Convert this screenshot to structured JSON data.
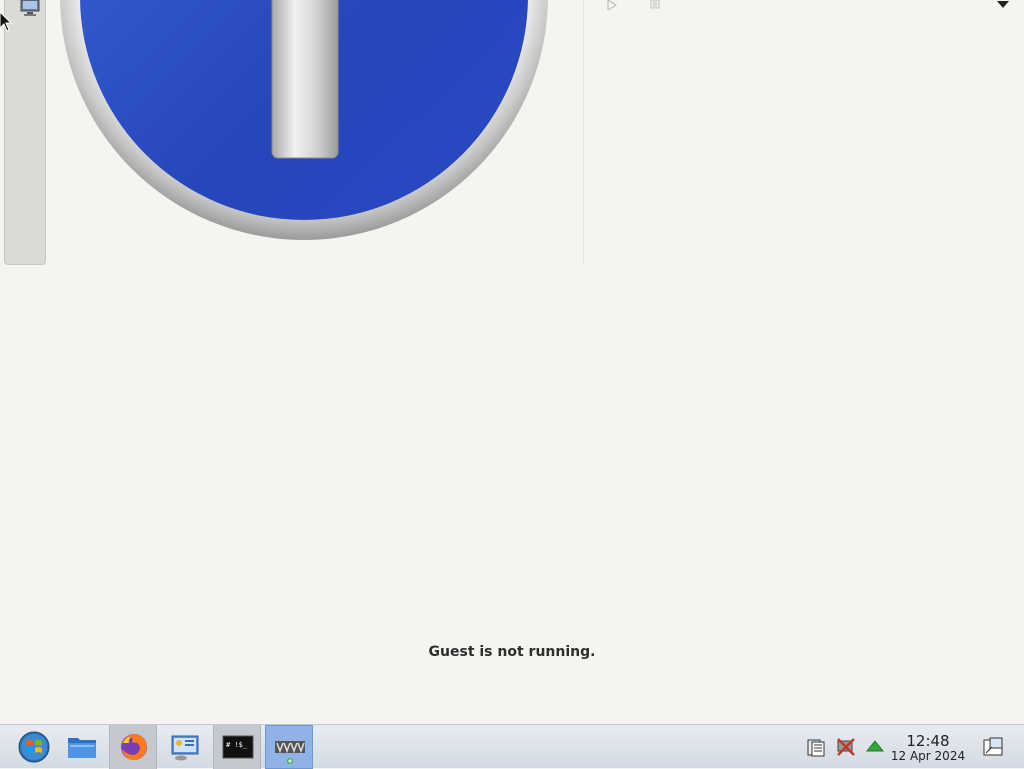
{
  "main": {
    "status_message": "Guest is not running."
  },
  "icons": {
    "sidebar": "monitor-icon",
    "hero": "info-icon",
    "toolbar": [
      "play-icon",
      "pause-icon",
      "dropdown-arrow-icon"
    ]
  },
  "taskbar": {
    "apps": [
      {
        "name": "start-menu",
        "icon": "windows-logo-icon"
      },
      {
        "name": "file-manager",
        "icon": "folder-icon"
      },
      {
        "name": "firefox",
        "icon": "firefox-icon",
        "active": true
      },
      {
        "name": "system-settings",
        "icon": "control-panel-icon"
      },
      {
        "name": "terminal",
        "icon": "terminal-icon",
        "active": true
      },
      {
        "name": "virtual-machine-manager",
        "icon": "vm-icon",
        "selected": true
      }
    ],
    "tray": [
      "clipboard-icon",
      "network-disconnected-icon",
      "update-arrow-icon"
    ],
    "clock": {
      "time": "12:48",
      "date": "12 Apr 2024"
    }
  },
  "colors": {
    "info_blue": "#2b4fc9",
    "background": "#f5f4f1",
    "taskbar_selected": "#8fb3e6"
  }
}
